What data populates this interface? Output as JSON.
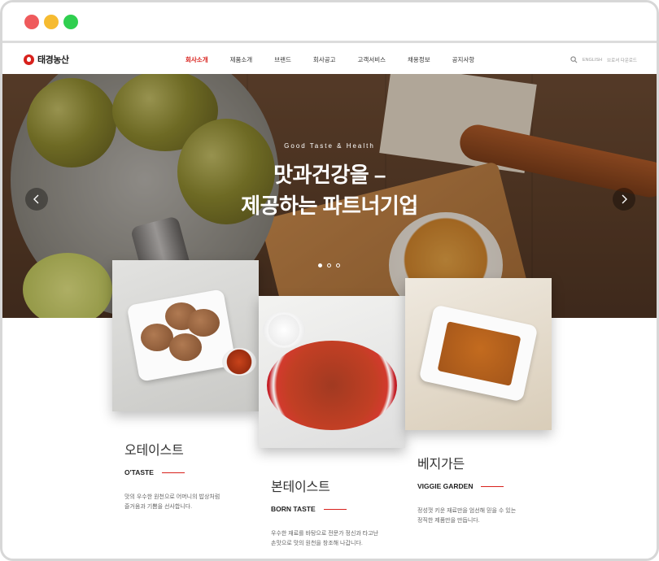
{
  "brand": {
    "logo_text": "태경농산",
    "accent": "#d8211c"
  },
  "window": {
    "controls": [
      "close",
      "minimize",
      "maximize"
    ]
  },
  "nav": {
    "items": [
      "회사소개",
      "제품소개",
      "브랜드",
      "회사공고",
      "고객서비스",
      "채용정보",
      "공지사항"
    ],
    "active_index": 0
  },
  "utility": {
    "search_icon": "search-icon",
    "lang": "ENGLISH",
    "extra": "브로셔 다운로드"
  },
  "hero": {
    "tag": "Good Taste & Health",
    "line1": "맛과건강을 –",
    "line2": "제공하는 파트너기업",
    "slides": 3,
    "active_slide": 0
  },
  "products": [
    {
      "name_ko": "오테이스트",
      "name_en": "O'TASTE",
      "desc_line1": "맛의 우수한 원천으로 어머니의 밥상처럼",
      "desc_line2": "즐거움과 기쁨을 선사합니다."
    },
    {
      "name_ko": "본테이스트",
      "name_en": "BORN TASTE",
      "desc_line1": "우수한 재료를 바탕으로 전문가 정신과 타고난",
      "desc_line2": "손맛으로 맛의 원천을 창조해 나갑니다."
    },
    {
      "name_ko": "베지가든",
      "name_en": "VIGGIE GARDEN",
      "desc_line1": "정성껏 키운 재료만을 엄선해 믿을 수 있는",
      "desc_line2": "정직한 제품만을 만듭니다."
    }
  ]
}
